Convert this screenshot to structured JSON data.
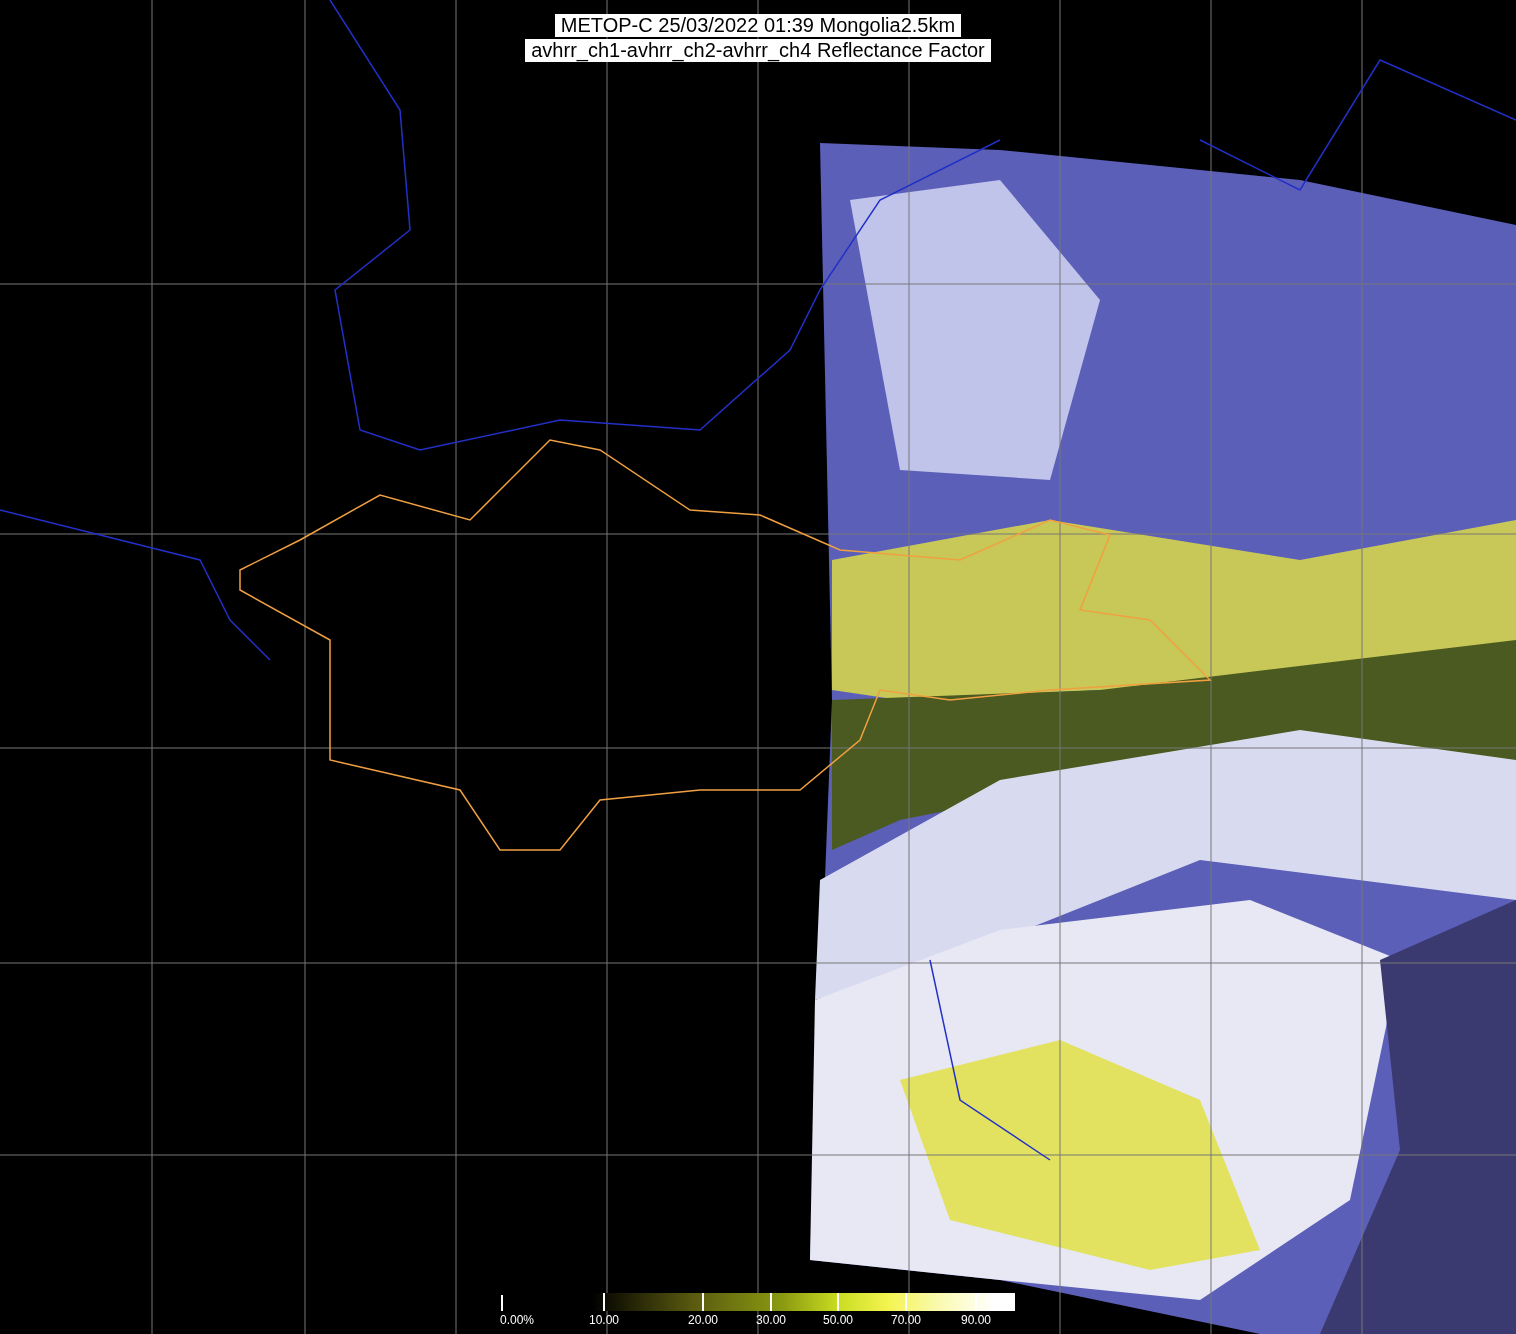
{
  "title": [
    "METOP-C 25/03/2022 01:39 Mongolia2.5km",
    "avhrr_ch1-avhrr_ch2-avhrr_ch4 Reflectance Factor"
  ],
  "colorbar": {
    "ticks": [
      "0.00%",
      "10.00",
      "20.00",
      "30.00",
      "50.00",
      "70.00",
      "90.00"
    ]
  }
}
